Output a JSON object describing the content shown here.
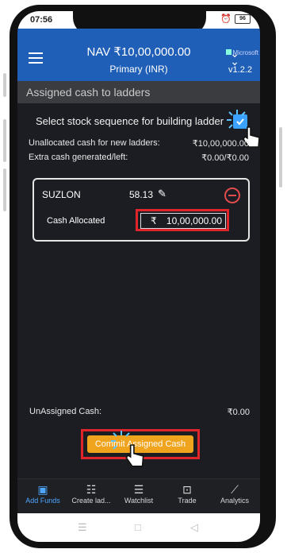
{
  "status": {
    "time": "07:56",
    "battery": "96"
  },
  "appbar": {
    "nav": "NAV ₹10,00,000.00",
    "portfolio": "Primary (INR)",
    "version": "v1.2.2",
    "brand": "Microsoft",
    "icons": [
      "menu-icon",
      "double-chevron-down-icon"
    ]
  },
  "section": {
    "title": "Assigned cash to ladders"
  },
  "sequence": {
    "label": "Select stock sequence for building ladder",
    "checked": true
  },
  "summary": {
    "unallocated_label": "Unallocated cash for new ladders:",
    "unallocated_value": "₹10,00,000.00",
    "extra_label": "Extra cash generated/left:",
    "extra_value": "₹0.00/₹0.00"
  },
  "card": {
    "stock": "SUZLON",
    "price": "58.13",
    "cash_label": "Cash Allocated",
    "currency": "₹",
    "cash_value": "10,00,000.00"
  },
  "unassigned": {
    "label": "UnAssigned Cash:",
    "value": "₹0.00"
  },
  "commit_label": "Commit Assigned Cash",
  "tabs": [
    {
      "label": "Add Funds",
      "icon": "wallet-icon",
      "active": true
    },
    {
      "label": "Create lad...",
      "icon": "ladder-icon"
    },
    {
      "label": "Watchlist",
      "icon": "list-icon"
    },
    {
      "label": "Trade",
      "icon": "briefcase-icon"
    },
    {
      "label": "Analytics",
      "icon": "chart-icon"
    }
  ],
  "colors": {
    "appbar": "#1f5fb8",
    "accent": "#f0a31c",
    "highlight": "#e0262b",
    "active_tab": "#4ea7ff"
  }
}
